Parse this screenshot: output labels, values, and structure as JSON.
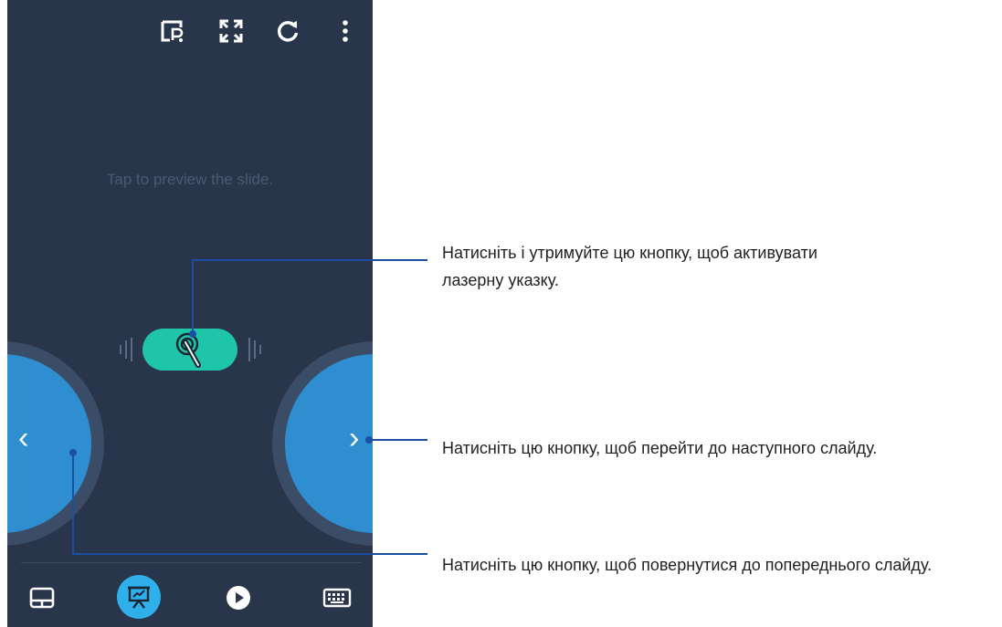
{
  "screen": {
    "hint_text": "Tap to preview the slide."
  },
  "top_toolbar": {
    "icons": [
      "presenter-notes-icon",
      "fullscreen-icon",
      "refresh-icon",
      "more-vertical-icon"
    ]
  },
  "controls": {
    "prev_glyph": "‹",
    "next_glyph": "›",
    "laser_icon": "laser-pointer-icon"
  },
  "bottom_bar": {
    "icons": [
      "touchpad-icon",
      "presentation-icon",
      "play-icon",
      "keyboard-icon"
    ],
    "active": "presentation-icon"
  },
  "callouts": {
    "laser": "Натисніть і утримуйте цю кнопку, щоб активувати\nлазерну указку.",
    "next": "Натисніть цю кнопку, щоб перейти до наступного слайду.",
    "prev": "Натисніть цю кнопку, щоб повернутися до попереднього слайду."
  },
  "colors": {
    "phone_background": "#29354a",
    "laser_button": "#1fc5a8",
    "nav_button": "#2e8ed0",
    "active_tab": "#2fb0ea",
    "callout_line": "#1a4fa3"
  }
}
